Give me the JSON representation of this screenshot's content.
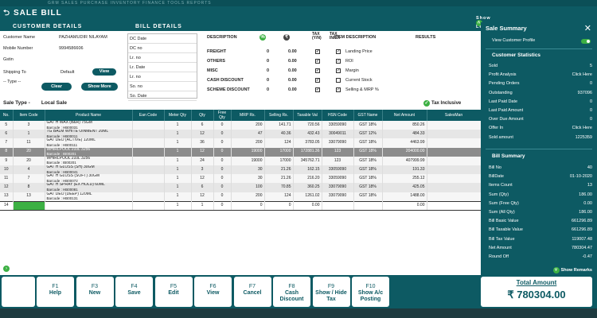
{
  "top_menu": "GRM  SALES  PURCHASE  INVENTORY  FINANCE  TOOLS  REPORTS",
  "page_title": "SALE BILL",
  "headers": {
    "customer": "CUSTOMER DETAILS",
    "bill": "BILL DETAILS",
    "show_less": "Show Less"
  },
  "customer": {
    "name_label": "Customer Name",
    "name": "PAZHAMUDIR NILAYAM",
    "mobile_label": "Mobile Number",
    "mobile": "9994586606",
    "gstin_label": "Gstin",
    "shipping_label": "Shipping To",
    "shipping_value": "Default",
    "view_label": "View",
    "type_placeholder": "-- Type --",
    "clear_label": "Clear",
    "show_more_label": "Show More"
  },
  "bill_details": [
    "DC Date",
    "DC no",
    "Lr. no",
    "Lr. Date",
    "Lr. no",
    "So. no",
    "So. Date"
  ],
  "charges": {
    "headers": {
      "description": "DESCRIPTION",
      "tax_yn": "TAX (Y/N)",
      "tax_inex": "TAX IN/EX"
    },
    "rows": [
      {
        "name": "FREIGHT",
        "pct": "0",
        "amt": "0.00"
      },
      {
        "name": "OTHERS",
        "pct": "0",
        "amt": "0.00"
      },
      {
        "name": "MISC",
        "pct": "0",
        "amt": "0.00"
      },
      {
        "name": "CASH DISCOUNT",
        "pct": "0",
        "amt": "0.00"
      },
      {
        "name": "SCHEME DISCOUNT",
        "pct": "0",
        "amt": "0.00"
      }
    ]
  },
  "item_desc": {
    "header": "ITEM DESCRIPTION",
    "results_header": "RESULTS",
    "options": [
      "Landing Price",
      "ROI",
      "Margin",
      "Current Stock",
      "Selling & MRP %"
    ]
  },
  "sale_type": {
    "label": "Sale Type -",
    "value": "Local Sale",
    "tax_inclusive": "Tax Inclusive"
  },
  "table": {
    "columns": [
      "No.",
      "Item Code",
      "Product Name",
      "Ean Code",
      "Meter Qty",
      "Qty",
      "Free Qty",
      "MRP Rs.",
      "Selling Rs.",
      "Taxable Val",
      "HSN Code",
      "GST Name",
      "Net Amount",
      "SalesMan"
    ],
    "rows": [
      {
        "no": "5",
        "code": "3",
        "name": "GAT H WAX (B&R) 75GM",
        "barcode": "Barcode : HB00031",
        "meter": "1",
        "qty": "6",
        "free": "0",
        "mrp": "200",
        "sell": "141.71",
        "taxable": "720.56",
        "hsn": "33059090",
        "gst": "GST 18%",
        "net": "850.26"
      },
      {
        "no": "6",
        "code": "1",
        "name": "TG BALM WHITE OINMENT 20ML",
        "barcode": "Barcode : HB00011",
        "meter": "1",
        "qty": "12",
        "free": "0",
        "mrp": "47",
        "sell": "40.36",
        "taxable": "432.43",
        "hsn": "30049011",
        "gst": "GST 12%",
        "net": "484.33"
      },
      {
        "no": "7",
        "code": "11",
        "name": "GAT DEO (ACTIVE) 120ML",
        "barcode": "Barcode : HB00111",
        "meter": "1",
        "qty": "36",
        "free": "0",
        "mrp": "200",
        "sell": "124",
        "taxable": "3783.05",
        "hsn": "33079090",
        "gst": "GST 18%",
        "net": "4463.99"
      },
      {
        "no": "8",
        "code": "20",
        "name": "WHIRLPOOL 210L 3256",
        "barcode": "Barcode : IB00201",
        "meter": "1",
        "qty": "12",
        "free": "0",
        "mrp": "19000",
        "sell": "17000",
        "taxable": "172881.36",
        "hsn": "123",
        "gst": "GST 18%",
        "net": "204000.00"
      },
      {
        "no": "9",
        "code": "20",
        "name": "WHIRLPOOL 210L 3256",
        "barcode": "Barcode : IB00201",
        "meter": "1",
        "qty": "24",
        "free": "0",
        "mrp": "19000",
        "sell": "17000",
        "taxable": "345762.71",
        "hsn": "123",
        "gst": "GST 18%",
        "net": "407999.99"
      },
      {
        "no": "10",
        "code": "4",
        "name": "GAT H GLOSS (SH) 30GM",
        "barcode": "Barcode : HB00041",
        "meter": "1",
        "qty": "3",
        "free": "0",
        "mrp": "30",
        "sell": "21.26",
        "taxable": "162.15",
        "hsn": "33059090",
        "gst": "GST 18%",
        "net": "191.33"
      },
      {
        "no": "11",
        "code": "7",
        "name": "GAT H GLOSS (SOFT) 30GM",
        "barcode": "Barcode : HB00072",
        "meter": "1",
        "qty": "12",
        "free": "0",
        "mrp": "30",
        "sell": "21.26",
        "taxable": "216.20",
        "hsn": "33059090",
        "gst": "GST 18%",
        "net": "255.12"
      },
      {
        "no": "12",
        "code": "8",
        "name": "GAT H SPRAY (EX HOLD) 60ML",
        "barcode": "Barcode : HB00081",
        "meter": "1",
        "qty": "6",
        "free": "0",
        "mrp": "100",
        "sell": "70.85",
        "taxable": "360.25",
        "hsn": "33079090",
        "gst": "GST 18%",
        "net": "425.05"
      },
      {
        "no": "13",
        "code": "13",
        "name": "GAT DEO (DEEP) 120ML",
        "barcode": "Barcode : HB00131",
        "meter": "1",
        "qty": "12",
        "free": "0",
        "mrp": "200",
        "sell": "124",
        "taxable": "1261.02",
        "hsn": "33079090",
        "gst": "GST 18%",
        "net": "1488.00"
      },
      {
        "no": "14",
        "code": "",
        "name": "",
        "barcode": "",
        "meter": "1",
        "qty": "1",
        "free": "0",
        "mrp": "0",
        "sell": "0",
        "taxable": "0.00",
        "hsn": "",
        "gst": "",
        "net": "0.00"
      }
    ]
  },
  "fkeys": [
    {
      "key": "F1",
      "label": "Help"
    },
    {
      "key": "F3",
      "label": "New"
    },
    {
      "key": "F4",
      "label": "Save"
    },
    {
      "key": "F5",
      "label": "Edit"
    },
    {
      "key": "F6",
      "label": "View"
    },
    {
      "key": "F7",
      "label": "Cancel"
    },
    {
      "key": "F8",
      "label": "Cash Discount"
    },
    {
      "key": "F9",
      "label": "Show / Hide Tax"
    },
    {
      "key": "F10",
      "label": "Show A/c Posting"
    }
  ],
  "sidebar": {
    "title": "Sale Summary",
    "view_profile": "View Customer Profile",
    "stats_title": "Customer Statistics",
    "stats": [
      {
        "k": "Sold",
        "v": "5"
      },
      {
        "k": "Profit Analysis",
        "v": "Click Here"
      },
      {
        "k": "Pending Orders",
        "v": "0"
      },
      {
        "k": "Outstanding",
        "v": "937096"
      },
      {
        "k": "Last Paid Date",
        "v": "0"
      },
      {
        "k": "Last Paid Amount",
        "v": "0"
      },
      {
        "k": "Over Due Amount",
        "v": "0"
      },
      {
        "k": "Offer In",
        "v": "Click Here"
      },
      {
        "k": "Sold amount",
        "v": "1225359"
      }
    ],
    "bill_title": "Bill Summary",
    "bill": [
      {
        "k": "Bill No",
        "v": "40"
      },
      {
        "k": "BillDate",
        "v": "01-10-2020"
      },
      {
        "k": "Items Count",
        "v": "13"
      },
      {
        "k": "Sum (Qty)",
        "v": "186.00"
      },
      {
        "k": "Sum (Free Qty)",
        "v": "0.00"
      },
      {
        "k": "Sum (All Qty)",
        "v": "186.00"
      },
      {
        "k": "Bill Basic Value",
        "v": "661296.89"
      },
      {
        "k": "Bill Taxable Value",
        "v": "661296.89"
      },
      {
        "k": "Bill Tax Value",
        "v": "119007.48"
      },
      {
        "k": "Net Amount",
        "v": "780304.47"
      },
      {
        "k": "Round Off",
        "v": "-0.47"
      }
    ],
    "show_remarks": "Show Remarks"
  },
  "total": {
    "label": "Total Amount",
    "value": "₹ 780304.00"
  },
  "colors": {
    "primary": "#0d5a63",
    "accent": "#3cb043"
  }
}
